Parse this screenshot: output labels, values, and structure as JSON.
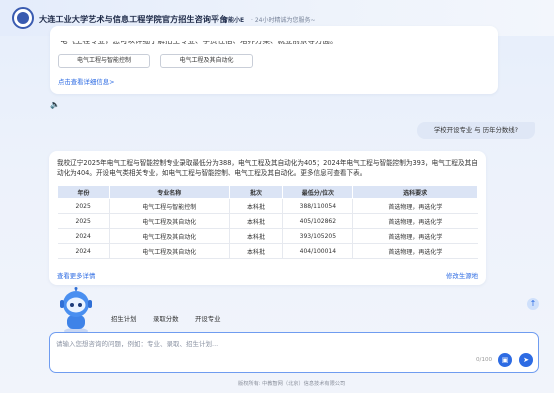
{
  "header": {
    "title": "大连工业大学艺术与信息工程学院官方招生咨询平台",
    "separator": "|",
    "brand": "智能小E",
    "tagline": "· 24小时精诚为您服务~"
  },
  "prev_message": {
    "cut_text": "电气工程专业，您可以详细了解招生专业、学费住宿、培养方案、就业前景等方面。",
    "chips": [
      "电气工程与智能控制",
      "电气工程及其自动化"
    ],
    "more_link": "点击查看详细信息>"
  },
  "user_question": "学校开设专业 与 历年分数线?",
  "answer": {
    "text": "我校辽宁2025年电气工程与智能控制专业录取最低分为388，电气工程及其自动化为405；2024年电气工程与智能控制为393，电气工程及其自动化为404。开设电气类相关专业，如电气工程与智能控制、电气工程及其自动化。更多信息可查看下表。",
    "table": {
      "headers": [
        "年份",
        "专业名称",
        "批次",
        "最低分/位次",
        "选科要求"
      ],
      "rows": [
        [
          "2025",
          "电气工程与智能控制",
          "本科批",
          "388/110054",
          "首选物理，再选化学"
        ],
        [
          "2025",
          "电气工程及其自动化",
          "本科批",
          "405/102862",
          "首选物理，再选化学"
        ],
        [
          "2024",
          "电气工程及其自动化",
          "本科批",
          "393/105205",
          "首选物理，再选化学"
        ],
        [
          "2024",
          "电气工程及其自动化",
          "本科批",
          "404/100014",
          "首选物理，再选化学"
        ]
      ]
    },
    "view_more": "查看更多详情",
    "change_source": "修改生源地"
  },
  "quick_actions": [
    "招生计划",
    "录取分数",
    "开设专业"
  ],
  "input": {
    "placeholder": "请输入您想咨询的问题，例如：专业、录取、招生计划...",
    "counter": "0/100"
  },
  "icons": {
    "speaker": "speaker-icon",
    "scroll_top": "arrow-up-icon",
    "attach": "image-icon",
    "send": "send-icon"
  },
  "colors": {
    "accent": "#2d6be3",
    "table_header": "#dbe4f5",
    "bubble": "#dfe7f6"
  },
  "footer": "版权所有: 中教智网（北京）信息技术有限公司"
}
